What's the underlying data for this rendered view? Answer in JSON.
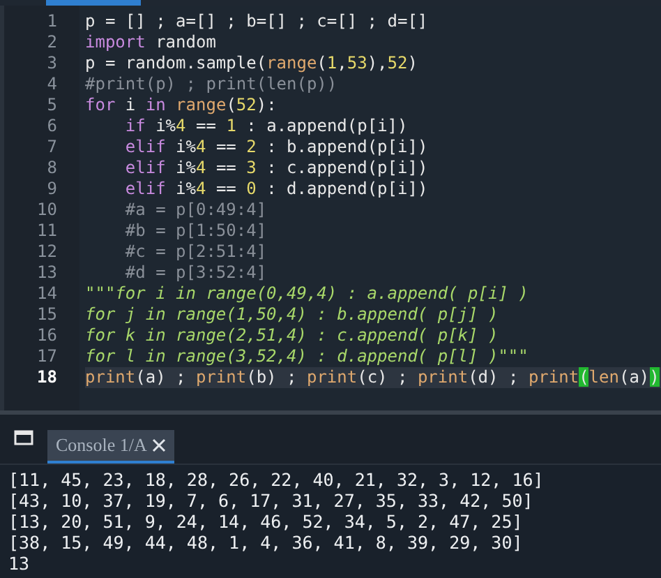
{
  "editor": {
    "lines": [
      {
        "number": "1",
        "current": false,
        "tokens": [
          {
            "kind": "plain",
            "text": "p = [] ; a=[] ; b=[] ; c=[] ; d=[]"
          }
        ]
      },
      {
        "number": "2",
        "current": false,
        "tokens": [
          {
            "kind": "keyword",
            "text": "import"
          },
          {
            "kind": "plain",
            "text": " random"
          }
        ]
      },
      {
        "number": "3",
        "current": false,
        "tokens": [
          {
            "kind": "plain",
            "text": "p = random.sample("
          },
          {
            "kind": "builtin",
            "text": "range"
          },
          {
            "kind": "plain",
            "text": "("
          },
          {
            "kind": "number",
            "text": "1"
          },
          {
            "kind": "plain",
            "text": ","
          },
          {
            "kind": "number",
            "text": "53"
          },
          {
            "kind": "plain",
            "text": "),"
          },
          {
            "kind": "number",
            "text": "52"
          },
          {
            "kind": "plain",
            "text": ")"
          }
        ]
      },
      {
        "number": "4",
        "current": false,
        "tokens": [
          {
            "kind": "comment",
            "text": "#print(p) ; print(len(p))"
          }
        ]
      },
      {
        "number": "5",
        "current": false,
        "tokens": [
          {
            "kind": "keyword",
            "text": "for"
          },
          {
            "kind": "plain",
            "text": " i "
          },
          {
            "kind": "keyword",
            "text": "in"
          },
          {
            "kind": "builtin",
            "text": " range"
          },
          {
            "kind": "plain",
            "text": "("
          },
          {
            "kind": "number",
            "text": "52"
          },
          {
            "kind": "plain",
            "text": "):"
          }
        ]
      },
      {
        "number": "6",
        "current": false,
        "tokens": [
          {
            "kind": "keyword",
            "text": "    if"
          },
          {
            "kind": "plain",
            "text": " i%"
          },
          {
            "kind": "number",
            "text": "4"
          },
          {
            "kind": "plain",
            "text": " == "
          },
          {
            "kind": "number",
            "text": "1"
          },
          {
            "kind": "plain",
            "text": " : a.append(p[i])"
          }
        ]
      },
      {
        "number": "7",
        "current": false,
        "tokens": [
          {
            "kind": "keyword",
            "text": "    elif"
          },
          {
            "kind": "plain",
            "text": " i%"
          },
          {
            "kind": "number",
            "text": "4"
          },
          {
            "kind": "plain",
            "text": " == "
          },
          {
            "kind": "number",
            "text": "2"
          },
          {
            "kind": "plain",
            "text": " : b.append(p[i])"
          }
        ]
      },
      {
        "number": "8",
        "current": false,
        "tokens": [
          {
            "kind": "keyword",
            "text": "    elif"
          },
          {
            "kind": "plain",
            "text": " i%"
          },
          {
            "kind": "number",
            "text": "4"
          },
          {
            "kind": "plain",
            "text": " == "
          },
          {
            "kind": "number",
            "text": "3"
          },
          {
            "kind": "plain",
            "text": " : c.append(p[i])"
          }
        ]
      },
      {
        "number": "9",
        "current": false,
        "tokens": [
          {
            "kind": "keyword",
            "text": "    elif"
          },
          {
            "kind": "plain",
            "text": " i%"
          },
          {
            "kind": "number",
            "text": "4"
          },
          {
            "kind": "plain",
            "text": " == "
          },
          {
            "kind": "number",
            "text": "0"
          },
          {
            "kind": "plain",
            "text": " : d.append(p[i])"
          }
        ]
      },
      {
        "number": "10",
        "current": false,
        "tokens": [
          {
            "kind": "comment",
            "text": "    #a = p[0:49:4]"
          }
        ]
      },
      {
        "number": "11",
        "current": false,
        "tokens": [
          {
            "kind": "comment",
            "text": "    #b = p[1:50:4]"
          }
        ]
      },
      {
        "number": "12",
        "current": false,
        "tokens": [
          {
            "kind": "comment",
            "text": "    #c = p[2:51:4]"
          }
        ]
      },
      {
        "number": "13",
        "current": false,
        "tokens": [
          {
            "kind": "comment",
            "text": "    #d = p[3:52:4]"
          }
        ]
      },
      {
        "number": "14",
        "current": false,
        "tokens": [
          {
            "kind": "string",
            "text": "\"\"\"for i in range(0,49,4) : a.append( p[i] )"
          }
        ]
      },
      {
        "number": "15",
        "current": false,
        "tokens": [
          {
            "kind": "string",
            "text": "for j in range(1,50,4) : b.append( p[j] )"
          }
        ]
      },
      {
        "number": "16",
        "current": false,
        "tokens": [
          {
            "kind": "string",
            "text": "for k in range(2,51,4) : c.append( p[k] )"
          }
        ]
      },
      {
        "number": "17",
        "current": false,
        "tokens": [
          {
            "kind": "string",
            "text": "for l in range(3,52,4) : d.append( p[l] )\"\"\""
          }
        ]
      },
      {
        "number": "18",
        "current": true,
        "tokens": [
          {
            "kind": "builtin",
            "text": "print"
          },
          {
            "kind": "plain",
            "text": "(a) ; "
          },
          {
            "kind": "builtin",
            "text": "print"
          },
          {
            "kind": "plain",
            "text": "(b) ; "
          },
          {
            "kind": "builtin",
            "text": "print"
          },
          {
            "kind": "plain",
            "text": "(c) ; "
          },
          {
            "kind": "builtin",
            "text": "print"
          },
          {
            "kind": "plain",
            "text": "(d) ; "
          },
          {
            "kind": "builtin",
            "text": "print"
          },
          {
            "kind": "match",
            "text": "("
          },
          {
            "kind": "builtin",
            "text": "len"
          },
          {
            "kind": "plain",
            "text": "(a)"
          },
          {
            "kind": "match",
            "text": ")"
          }
        ]
      }
    ]
  },
  "console": {
    "tabs": [
      {
        "label": "Console 1/A",
        "selected": true
      }
    ],
    "output": [
      "[11, 45, 23, 18, 28, 26, 22, 40, 21, 32, 3, 12, 16]",
      "[43, 10, 37, 19, 7, 6, 17, 31, 27, 35, 33, 42, 50]",
      "[13, 20, 51, 9, 24, 14, 46, 52, 34, 5, 2, 47, 25]",
      "[38, 15, 49, 44, 48, 1, 4, 36, 41, 8, 39, 29, 30]",
      "13"
    ]
  }
}
